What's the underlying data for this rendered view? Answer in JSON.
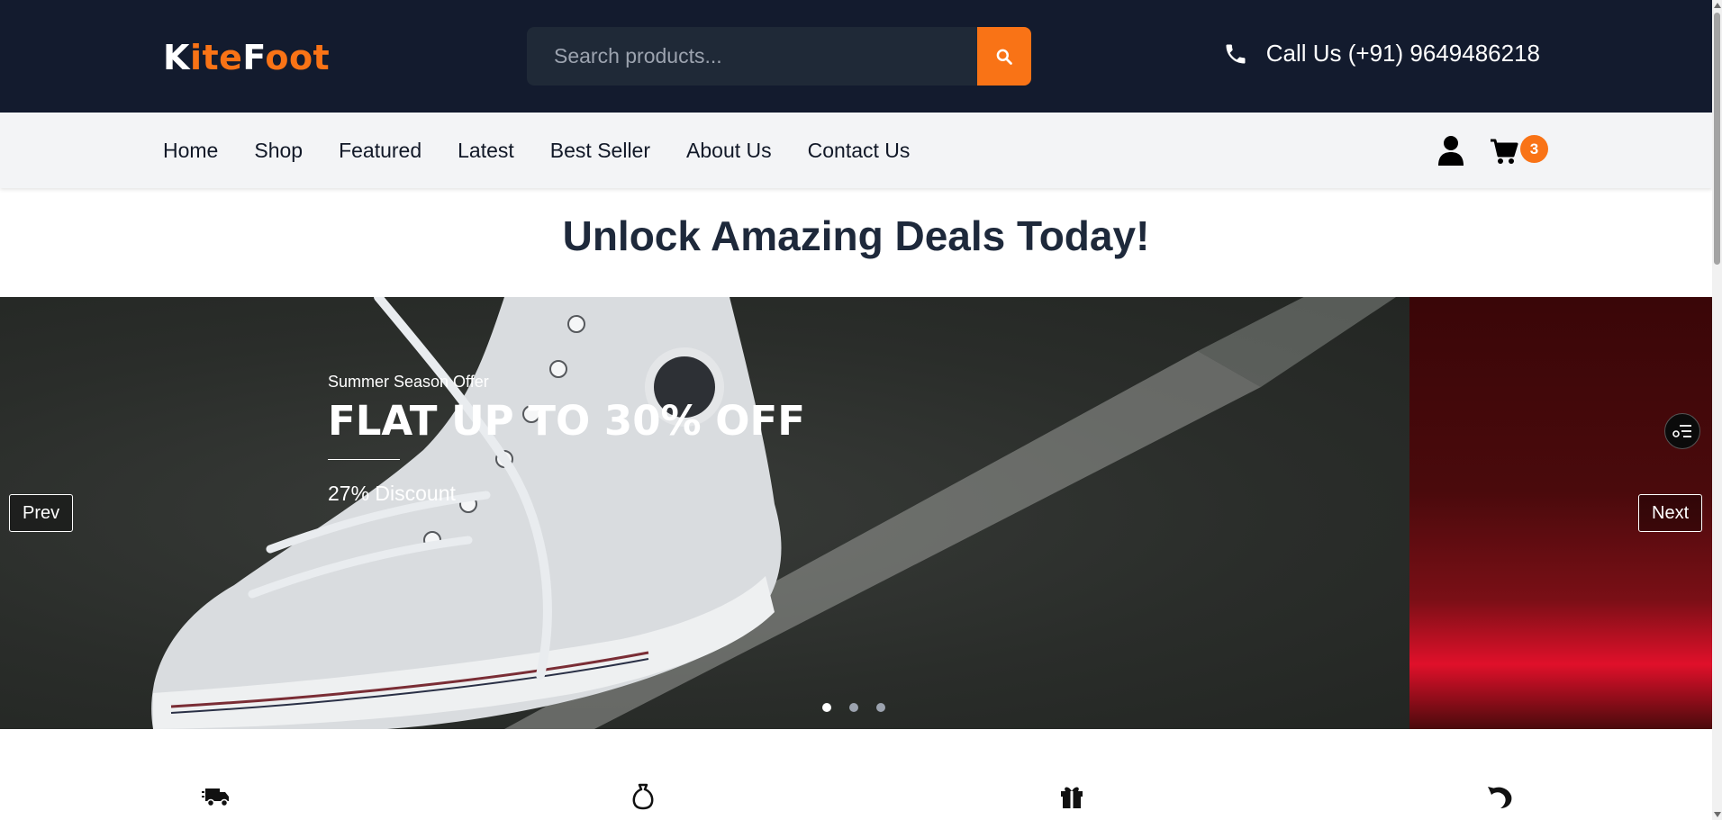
{
  "header": {
    "logo_first": "K",
    "logo_mid": "ite",
    "logo_last": "Foot",
    "search_placeholder": "Search products...",
    "phone_text": "Call Us (+91) 9649486218"
  },
  "nav": {
    "links": [
      "Home",
      "Shop",
      "Featured",
      "Latest",
      "Best Seller",
      "About Us",
      "Contact Us"
    ],
    "cart_count": "3"
  },
  "headline": "Unlock Amazing Deals Today!",
  "hero": {
    "subtitle": "Summer Season Offer",
    "title": "FLAT UP TO 30% OFF",
    "discount": "27% Discount",
    "prev_label": "Prev",
    "next_label": "Next",
    "active_slide": 1,
    "slide_count": 3
  },
  "features": {
    "icons": [
      "truck-icon",
      "money-bag-icon",
      "gift-icon",
      "return-arrow-icon"
    ]
  },
  "colors": {
    "header_bg": "#131b2e",
    "accent": "#f97316",
    "nav_bg": "#f3f4f6",
    "headline": "#1e293b"
  }
}
